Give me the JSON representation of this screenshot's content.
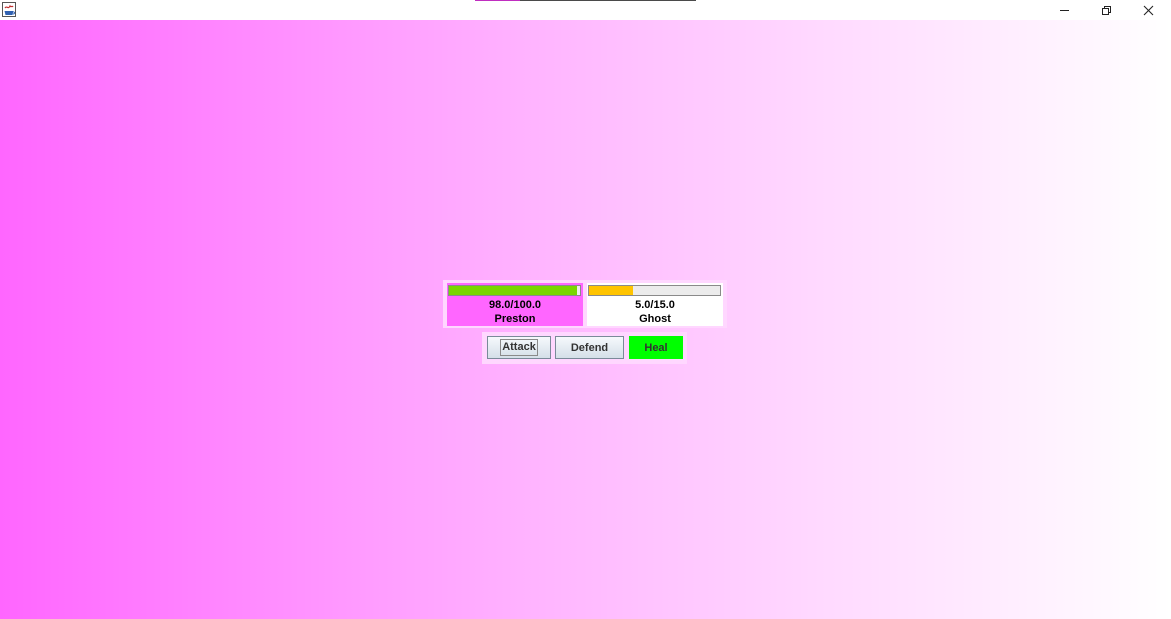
{
  "titlebar": {
    "app_icon": "java-cup-icon",
    "controls": {
      "minimize": "minimize-icon",
      "maximize": "restore-icon",
      "close": "close-icon"
    }
  },
  "battle": {
    "player": {
      "name": "Preston",
      "hp_text": "98.0/100.0",
      "hp_fraction": 0.98,
      "panel_color": "#ff66ff",
      "bar_color": "#7ad600"
    },
    "enemy": {
      "name": "Ghost",
      "hp_text": "5.0/15.0",
      "hp_fraction": 0.3333,
      "panel_color": "#ffffff",
      "bar_color": "#ffc400"
    }
  },
  "actions": {
    "attack_label": "Attack",
    "defend_label": "Defend",
    "heal_label": "Heal",
    "heal_color": "#00ff00"
  },
  "background": {
    "gradient_start": "#ff66ff",
    "gradient_end": "#ffffff"
  }
}
